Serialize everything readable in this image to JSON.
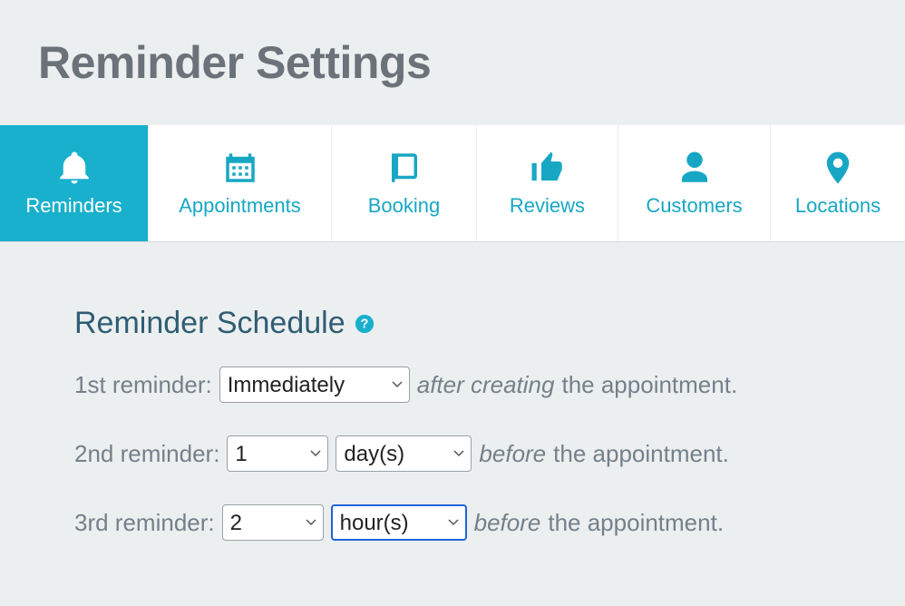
{
  "page_title": "Reminder Settings",
  "tabs": [
    {
      "label": "Reminders"
    },
    {
      "label": "Appointments"
    },
    {
      "label": "Booking"
    },
    {
      "label": "Reviews"
    },
    {
      "label": "Customers"
    },
    {
      "label": "Locations"
    }
  ],
  "section": {
    "title": "Reminder Schedule"
  },
  "reminders": [
    {
      "label": "1st reminder:",
      "immediate": "Immediately",
      "after_text": "after creating",
      "tail": "the appointment."
    },
    {
      "label": "2nd reminder:",
      "number": "1",
      "unit": "day(s)",
      "before_text": "before",
      "tail": "the appointment."
    },
    {
      "label": "3rd reminder:",
      "number": "2",
      "unit": "hour(s)",
      "before_text": "before",
      "tail": "the appointment."
    }
  ]
}
